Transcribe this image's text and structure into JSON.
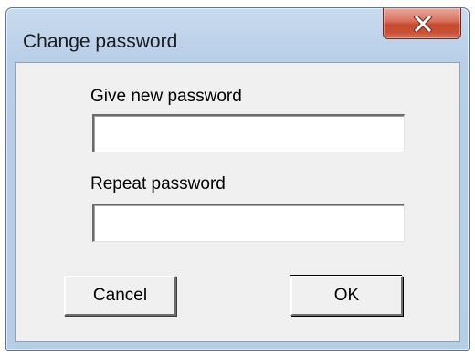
{
  "window": {
    "title": "Change password"
  },
  "form": {
    "new_password_label": "Give new password",
    "new_password_value": "",
    "repeat_password_label": "Repeat password",
    "repeat_password_value": ""
  },
  "buttons": {
    "cancel_label": "Cancel",
    "ok_label": "OK"
  },
  "icons": {
    "close": "close-icon"
  },
  "colors": {
    "title_bar": "#bed3ea",
    "close_button": "#c94f35",
    "client_area": "#f0f0f0"
  }
}
